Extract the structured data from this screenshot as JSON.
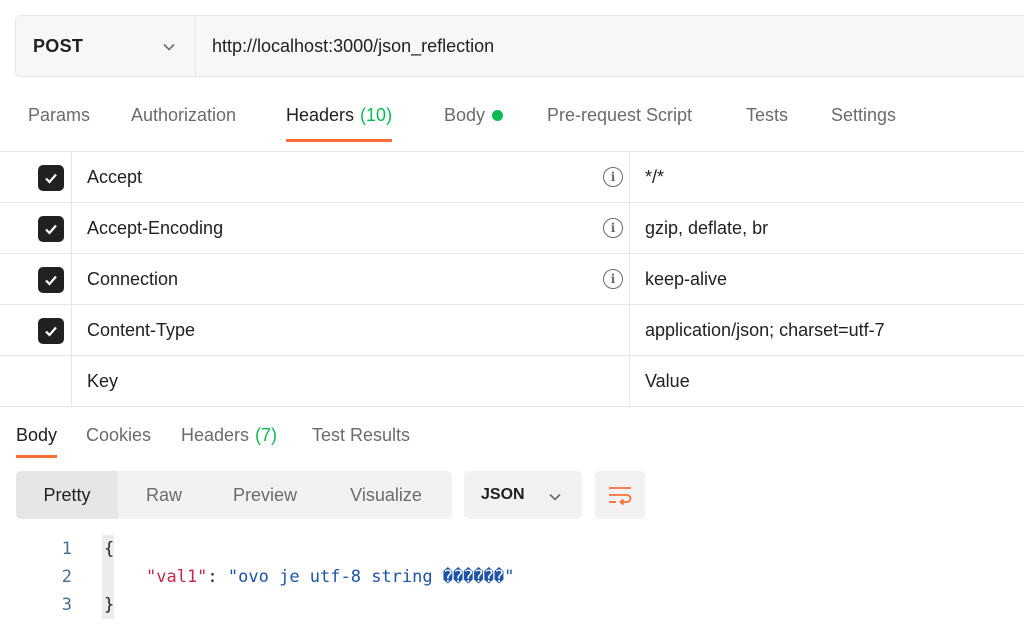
{
  "request": {
    "method": "POST",
    "url": "http://localhost:3000/json_reflection"
  },
  "request_tabs": {
    "params": "Params",
    "authorization": "Authorization",
    "headers": "Headers",
    "headers_count": "(10)",
    "body": "Body",
    "prerequest": "Pre-request Script",
    "tests": "Tests",
    "settings": "Settings"
  },
  "headers_table": {
    "rows": [
      {
        "key": "Accept",
        "value": "*/*"
      },
      {
        "key": "Accept-Encoding",
        "value": "gzip, deflate, br"
      },
      {
        "key": "Connection",
        "value": "keep-alive"
      },
      {
        "key": "Content-Type",
        "value": "application/json; charset=utf-7"
      }
    ],
    "key_placeholder": "Key",
    "value_placeholder": "Value"
  },
  "response_tabs": {
    "body": "Body",
    "cookies": "Cookies",
    "headers": "Headers",
    "headers_count": "(7)",
    "test_results": "Test Results"
  },
  "view_modes": {
    "pretty": "Pretty",
    "raw": "Raw",
    "preview": "Preview",
    "visualize": "Visualize"
  },
  "format_select": {
    "selected": "JSON"
  },
  "code": {
    "line_numbers": [
      "1",
      "2",
      "3"
    ],
    "open_brace": "{",
    "key": "\"val1\"",
    "colon": ": ",
    "value": "\"ovo je utf-8 string ������\"",
    "close_brace": "}"
  },
  "colors": {
    "accent": "#ff6c37",
    "success": "#0cbb52",
    "json_key": "#c6284a",
    "json_string": "#1d54a8"
  }
}
